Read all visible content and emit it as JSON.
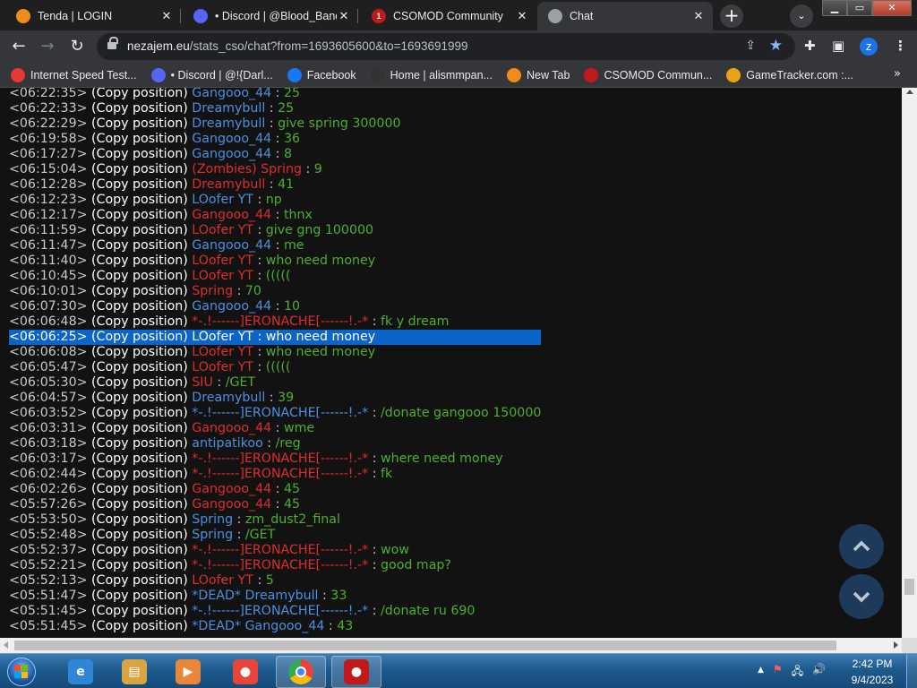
{
  "browser": {
    "tabs": [
      {
        "title": "Tenda | LOGIN",
        "icon": "tenda-icon",
        "color": "#f08c1c",
        "badge": "",
        "active": false
      },
      {
        "title": "• Discord | @Blood_Band",
        "icon": "discord-icon",
        "color": "#5865f2",
        "badge": "",
        "active": false
      },
      {
        "title": "CSOMOD Community",
        "icon": "csomod-icon",
        "color": "#c21a1a",
        "badge": "1",
        "active": false
      },
      {
        "title": "Chat",
        "icon": "globe-icon",
        "color": "#9aa0a6",
        "badge": "",
        "active": true
      }
    ],
    "close_glyph": "✕",
    "new_tab_glyph": "+",
    "tab_search_glyph": "⌄",
    "window_buttons": {
      "minimize": "▁",
      "maximize": "▭",
      "close": "✕"
    },
    "nav": {
      "back": "←",
      "forward": "→",
      "reload": "↻"
    },
    "url_host": "nezajem.eu",
    "url_path": "/stats_cso/chat?from=1693605600&to=1693691999",
    "profile_initial": "z",
    "bookmarks": [
      {
        "label": "Internet Speed Test...",
        "icon": "speedtest-icon",
        "color": "#e53935"
      },
      {
        "label": "• Discord | @!{Darl...",
        "icon": "discord-icon",
        "color": "#5865f2"
      },
      {
        "label": "Facebook",
        "icon": "facebook-icon",
        "color": "#1877f2"
      },
      {
        "label": "Home | alismmpan...",
        "icon": "alismm-icon",
        "color": "#333333"
      },
      {
        "label": "New Tab",
        "icon": "new-tab-icon",
        "color": "#f08c1c"
      },
      {
        "label": "CSOMOD Commun...",
        "icon": "csomod-icon",
        "color": "#c21a1a"
      },
      {
        "label": "GameTracker.com :...",
        "icon": "gametracker-icon",
        "color": "#e8a317"
      }
    ],
    "bookmarks_more": "»"
  },
  "chat": {
    "copy_label": "(Copy position)",
    "messages": [
      {
        "time": "<06:22:35>",
        "name": "Gangooo_44",
        "color": "blue",
        "text": "25"
      },
      {
        "time": "<06:22:33>",
        "name": "Dreamybull",
        "color": "blue",
        "text": "25"
      },
      {
        "time": "<06:22:29>",
        "name": "Dreamybull",
        "color": "blue",
        "text": "give spring 300000"
      },
      {
        "time": "<06:19:58>",
        "name": "Gangooo_44",
        "color": "blue",
        "text": "36"
      },
      {
        "time": "<06:17:27>",
        "name": "Gangooo_44",
        "color": "blue",
        "text": "8"
      },
      {
        "time": "<06:15:04>",
        "name": "(Zombies) Spring",
        "color": "red",
        "text": "9"
      },
      {
        "time": "<06:12:28>",
        "name": "Dreamybull",
        "color": "red",
        "text": "41"
      },
      {
        "time": "<06:12:23>",
        "name": "LOofer YT",
        "color": "blue",
        "text": "np"
      },
      {
        "time": "<06:12:17>",
        "name": "Gangooo_44",
        "color": "red",
        "text": "thnx"
      },
      {
        "time": "<06:11:59>",
        "name": "LOofer YT",
        "color": "red",
        "text": "give gng 100000"
      },
      {
        "time": "<06:11:47>",
        "name": "Gangooo_44",
        "color": "blue",
        "text": "me"
      },
      {
        "time": "<06:11:40>",
        "name": "LOofer YT",
        "color": "red",
        "text": "who need money"
      },
      {
        "time": "<06:10:45>",
        "name": "LOofer YT",
        "color": "red",
        "text": "((((("
      },
      {
        "time": "<06:10:01>",
        "name": "Spring",
        "color": "red",
        "text": "70"
      },
      {
        "time": "<06:07:30>",
        "name": "Gangooo_44",
        "color": "blue",
        "text": "10"
      },
      {
        "time": "<06:06:48>",
        "name": "*-.!------]ERONACHE[------!.-*",
        "color": "red",
        "text": "fk y dream"
      },
      {
        "time": "<06:06:25>",
        "name": "LOofer YT",
        "color": "red",
        "text": "who need money",
        "selected": true
      },
      {
        "time": "<06:06:08>",
        "name": "LOofer YT",
        "color": "red",
        "text": "who need money"
      },
      {
        "time": "<06:05:47>",
        "name": "LOofer YT",
        "color": "red",
        "text": "((((("
      },
      {
        "time": "<06:05:30>",
        "name": "SIU",
        "color": "red",
        "text": "/GET"
      },
      {
        "time": "<06:04:57>",
        "name": "Dreamybull",
        "color": "blue",
        "text": "39"
      },
      {
        "time": "<06:03:52>",
        "name": "*-.!------]ERONACHE[------!.-*",
        "color": "blue",
        "text": "/donate gangooo 150000"
      },
      {
        "time": "<06:03:31>",
        "name": "Gangooo_44",
        "color": "red",
        "text": "wme"
      },
      {
        "time": "<06:03:18>",
        "name": "antipatikoo",
        "color": "blue",
        "text": "/reg"
      },
      {
        "time": "<06:03:17>",
        "name": "*-.!------]ERONACHE[------!.-*",
        "color": "red",
        "text": "where need money"
      },
      {
        "time": "<06:02:44>",
        "name": "*-.!------]ERONACHE[------!.-*",
        "color": "red",
        "text": "fk"
      },
      {
        "time": "<06:02:26>",
        "name": "Gangooo_44",
        "color": "red",
        "text": "45"
      },
      {
        "time": "<05:57:26>",
        "name": "Gangooo_44",
        "color": "red",
        "text": "45"
      },
      {
        "time": "<05:53:50>",
        "name": "Spring",
        "color": "blue",
        "text": "zm_dust2_final"
      },
      {
        "time": "<05:52:48>",
        "name": "Spring",
        "color": "blue",
        "text": "/GET"
      },
      {
        "time": "<05:52:37>",
        "name": "*-.!------]ERONACHE[------!.-*",
        "color": "red",
        "text": "wow"
      },
      {
        "time": "<05:52:21>",
        "name": "*-.!------]ERONACHE[------!.-*",
        "color": "red",
        "text": "good map?"
      },
      {
        "time": "<05:52:13>",
        "name": "LOofer YT",
        "color": "red",
        "text": "5"
      },
      {
        "time": "<05:51:47>",
        "name": "*DEAD* Dreamybull",
        "color": "blue",
        "text": "33"
      },
      {
        "time": "<05:51:45>",
        "name": "*-.!------]ERONACHE[------!.-*",
        "color": "blue",
        "text": "/donate ru 690"
      },
      {
        "time": "<05:51:45>",
        "name": "*DEAD* Gangooo_44",
        "color": "blue",
        "text": "43"
      }
    ]
  },
  "scroll_buttons": {
    "up": "scroll-up-icon",
    "down": "scroll-down-icon"
  },
  "taskbar": {
    "apps": [
      {
        "name": "internet-explorer",
        "label": "e",
        "color": "#2f86d8"
      },
      {
        "name": "file-explorer",
        "label": "▤",
        "color": "#d9a441"
      },
      {
        "name": "media-player",
        "label": "▶",
        "color": "#e8873a"
      },
      {
        "name": "nox-player",
        "label": "●",
        "color": "#e8453a"
      },
      {
        "name": "chrome",
        "label": "",
        "color": "#4285f4"
      },
      {
        "name": "game-client",
        "label": "●",
        "color": "#c21a1a"
      }
    ],
    "tray_arrow": "▲",
    "tray_flag": "⚑",
    "tray_network": "🖧",
    "tray_volume": "🔊",
    "time": "2:42 PM",
    "date": "9/4/2023"
  }
}
